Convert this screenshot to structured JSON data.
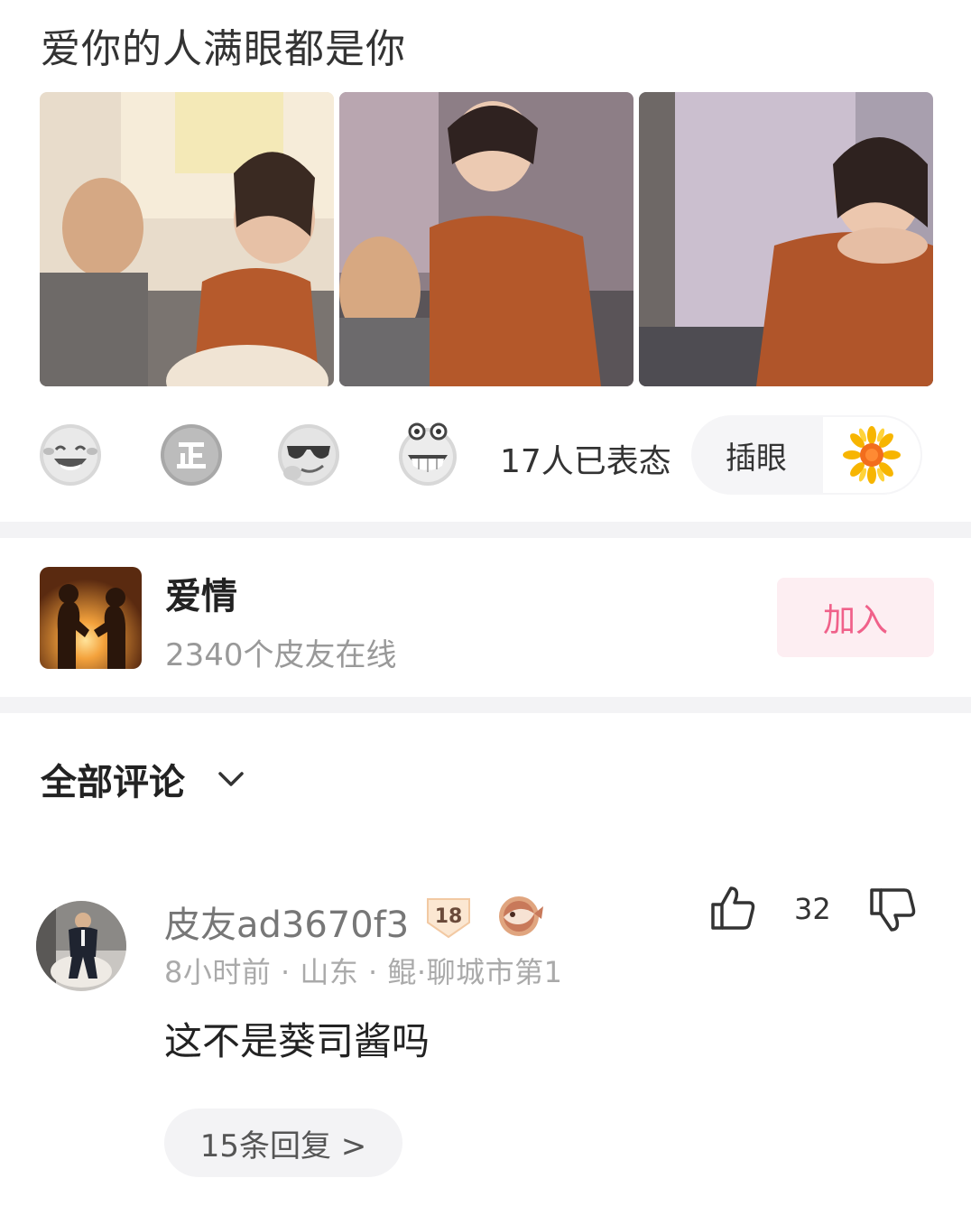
{
  "post": {
    "title": "爱你的人满眼都是你",
    "photos": [
      "photo-1",
      "photo-2",
      "photo-3"
    ]
  },
  "reactions": {
    "emojis": [
      "laugh-tears-icon",
      "zheng-icon",
      "cool-sunglasses-icon",
      "grin-icon"
    ],
    "count_text": "17人已表态",
    "vote_label": "插眼",
    "vote_icon": "sunflower-icon"
  },
  "group": {
    "name": "爱情",
    "online_text": "2340个皮友在线",
    "join_label": "加入"
  },
  "comments": {
    "header": "全部评论",
    "items": [
      {
        "user": "皮友ad3670f3",
        "level": "18",
        "meta": "8小时前 · 山东 · 鲲·聊城市第1",
        "text": "这不是葵司酱吗",
        "likes": "32",
        "replies_label": "15条回复 >"
      }
    ]
  },
  "colors": {
    "accent_pink": "#f0618a",
    "join_bg": "#fdeef2",
    "divider": "#f3f3f5"
  }
}
